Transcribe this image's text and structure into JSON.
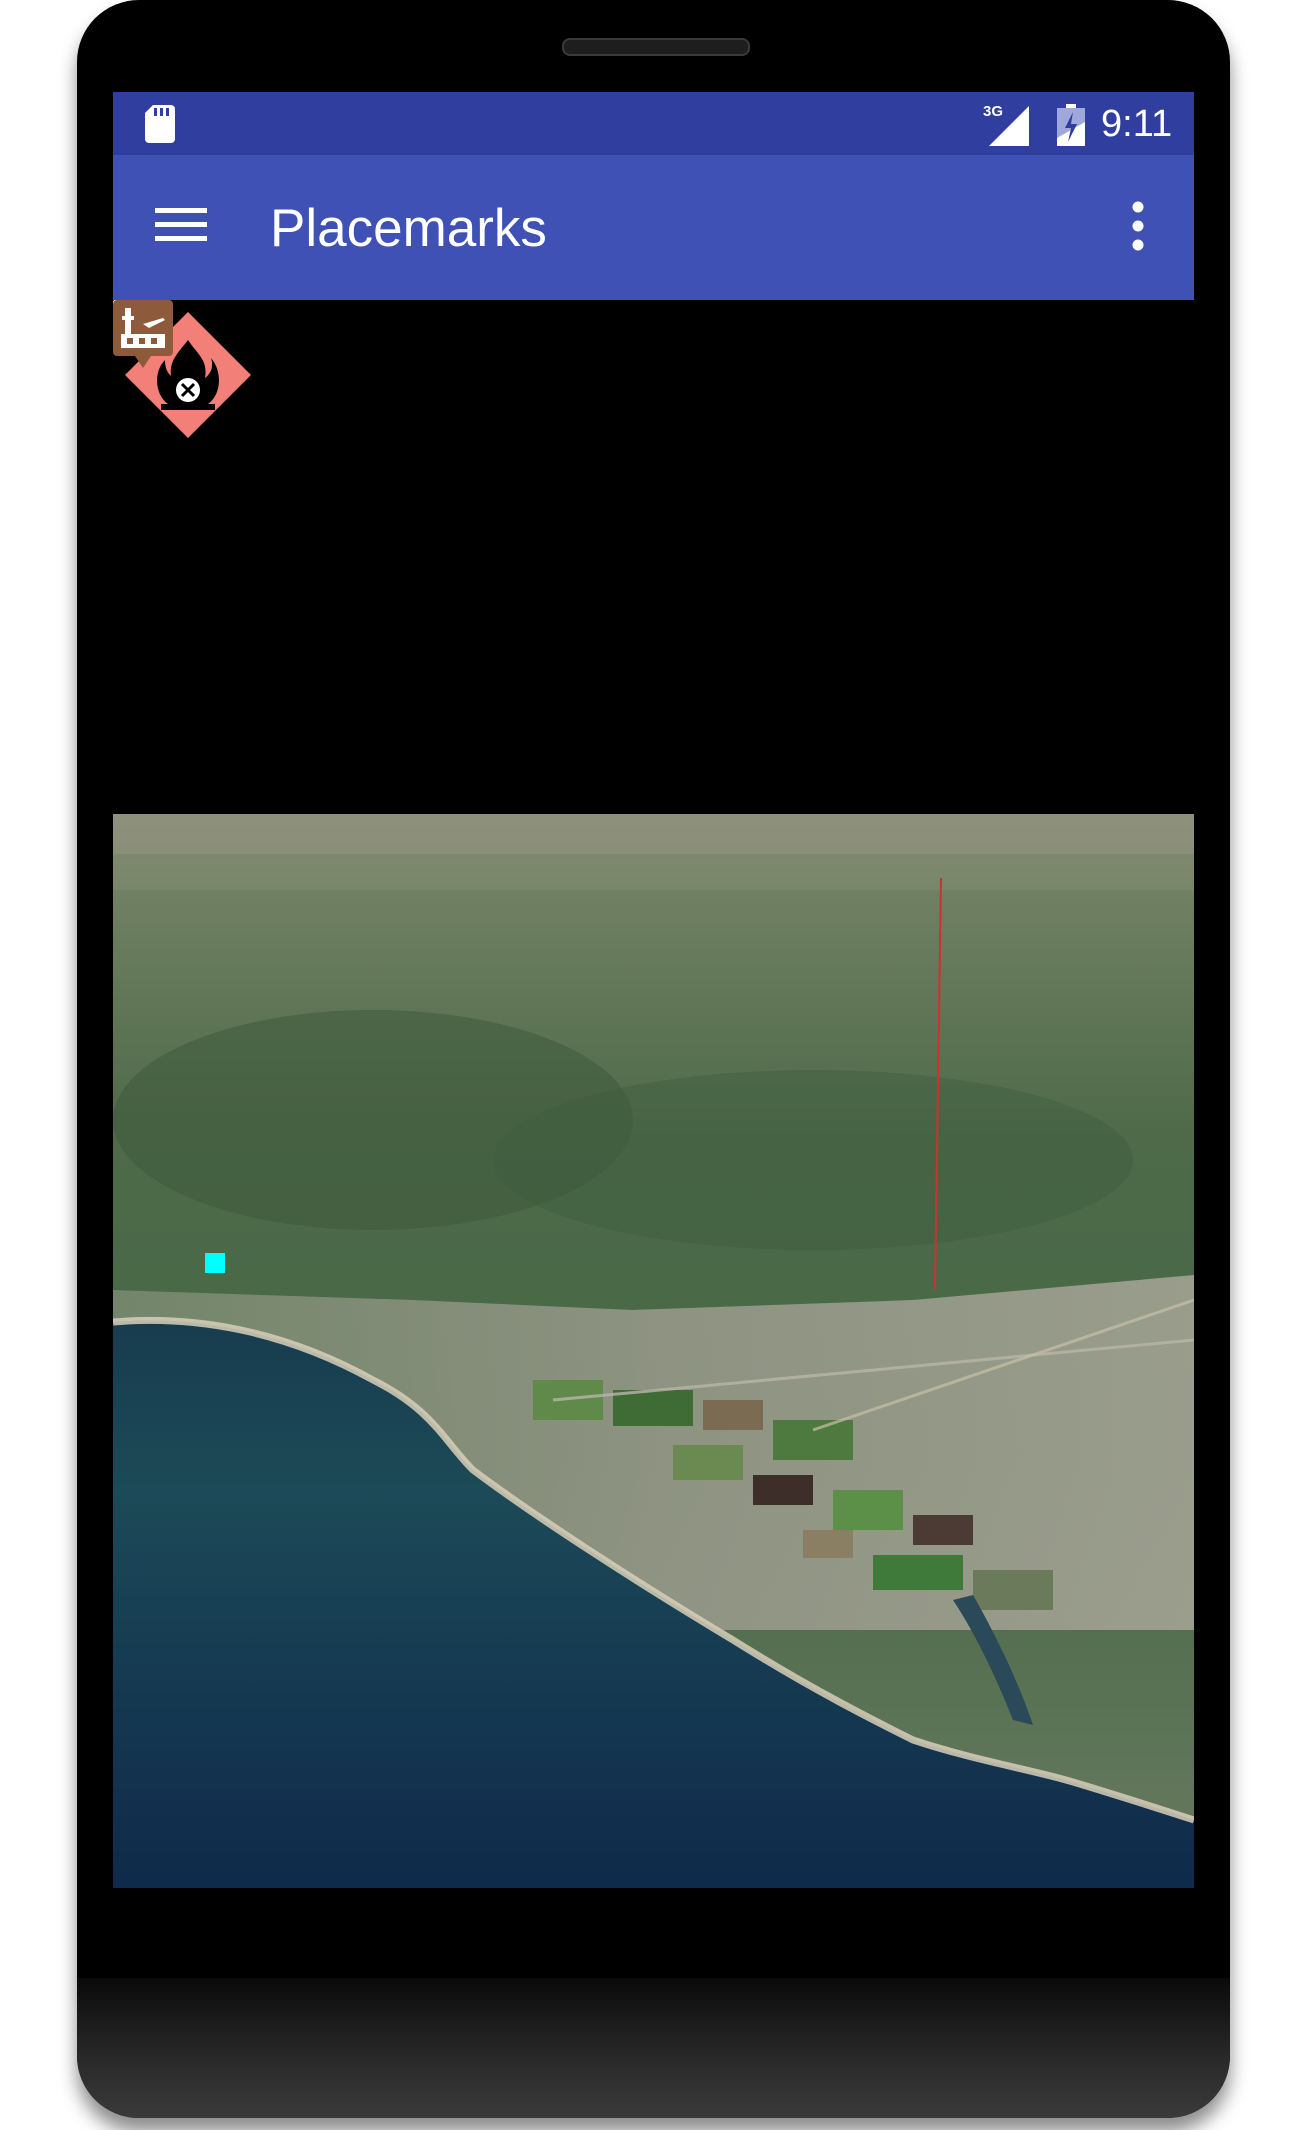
{
  "status_bar": {
    "time": "9:11",
    "network": "3G",
    "icons": [
      "sd-card-icon",
      "signal-icon",
      "battery-icon"
    ]
  },
  "app_bar": {
    "title": "Placemarks",
    "nav_icon": "menu-icon",
    "action_icon": "overflow-menu-icon"
  },
  "globe": {
    "placemarks": [
      {
        "name": "aircraft-placemark",
        "icon": "airplane-icon",
        "color": "#3f51b5"
      },
      {
        "name": "wildfire-placemark",
        "icon": "fire-hazard-icon",
        "color": "#f07b74"
      },
      {
        "name": "airport-placemark",
        "icon": "airport-icon",
        "color": "#8d5a3b"
      },
      {
        "name": "point-placemark",
        "icon": "square-point",
        "color": "#00ffff"
      }
    ]
  },
  "fab": {
    "icon": "info-icon",
    "color": "#ff4081"
  },
  "nav_bar": {
    "icons": [
      "back-icon",
      "home-icon",
      "recents-icon"
    ]
  },
  "colors": {
    "status_bar": "#303f9f",
    "app_bar": "#3f51b5",
    "accent": "#ff4081"
  }
}
